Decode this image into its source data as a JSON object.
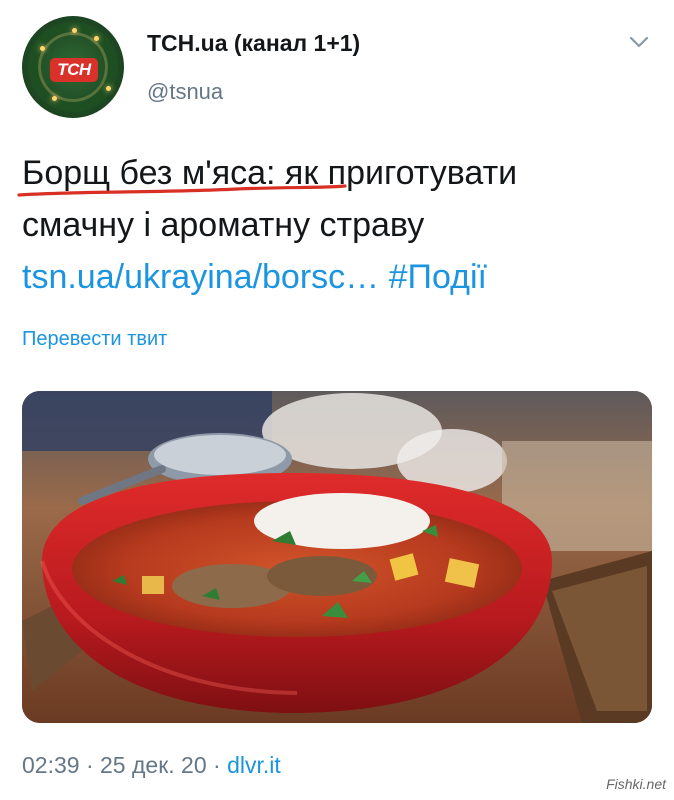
{
  "tweet": {
    "author_name": "ТСН.ua (канал 1+1)",
    "author_handle": "@tsnua",
    "avatar_logo_text": "ТСН",
    "text_line1_start": "Борщ без м'яса:",
    "text_line1_end": " як приготувати",
    "text_line2": "смачну і ароматну страву",
    "link_text": "tsn.ua/ukrayina/borsc…",
    "hashtag": "#Події",
    "translate_label": "Перевести твит",
    "time": "02:39",
    "date": "25 дек. 20",
    "separator": "·",
    "via": "dlvr.it"
  },
  "watermark": "Fishki.net",
  "colors": {
    "link": "#1b95e0",
    "secondary_text": "#657786",
    "primary_text": "#14171a",
    "annotation_underline": "#d93025"
  },
  "icons": {
    "menu": "chevron-down-icon"
  }
}
